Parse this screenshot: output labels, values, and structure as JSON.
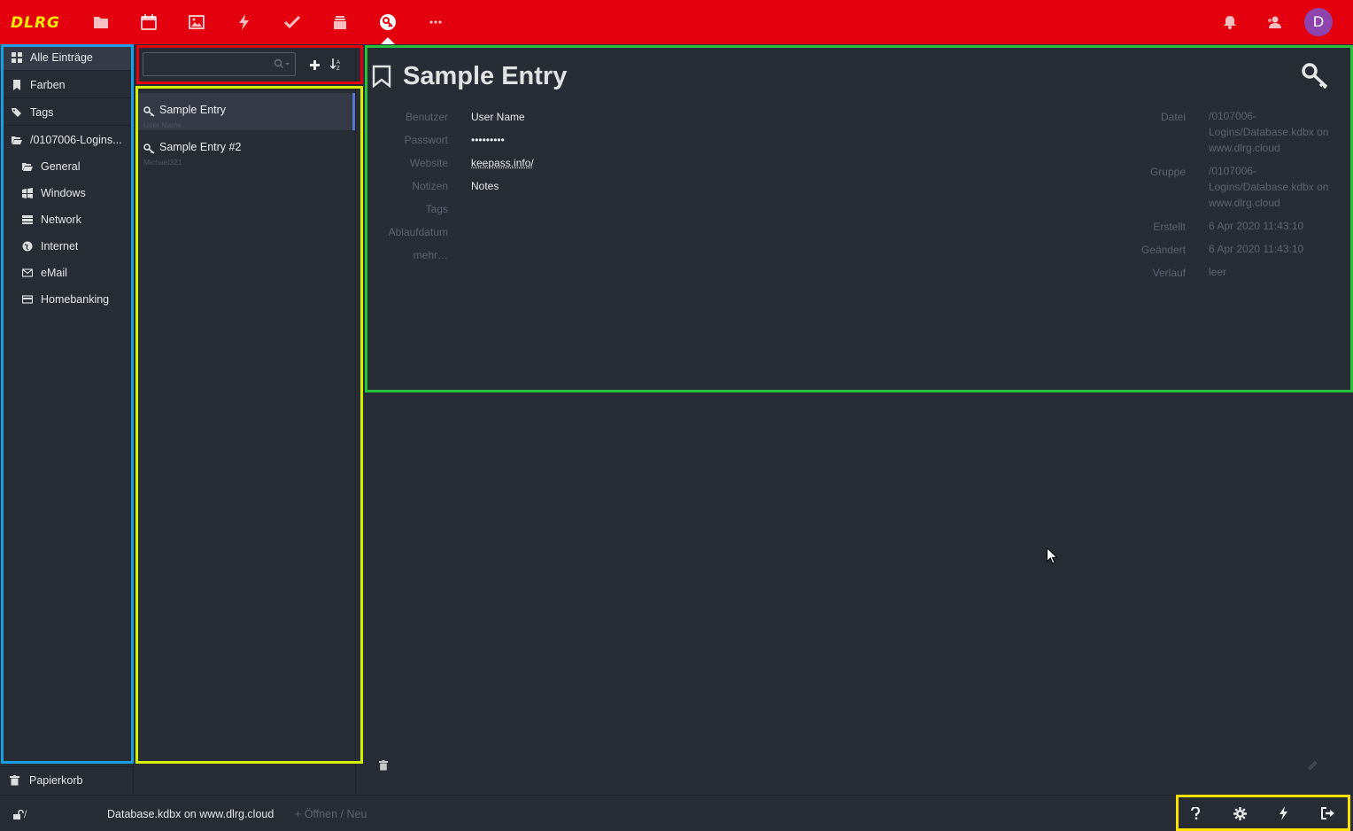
{
  "app": {
    "logo": "DLRG",
    "avatar_letter": "D",
    "brand_color": "#e3000f",
    "logo_color": "#ffed00",
    "avatar_color": "#8e44ad",
    "nav_icons": [
      "folder-icon",
      "calendar-icon",
      "image-icon",
      "bolt-icon",
      "check-icon",
      "inbox-icon",
      "keepass-icon",
      "more-icon",
      "bell-icon",
      "contacts-icon"
    ]
  },
  "sidebar": {
    "items": [
      {
        "label": "Alle Einträge",
        "icon": "grid-icon"
      },
      {
        "label": "Farben",
        "icon": "bookmark-icon"
      },
      {
        "label": "Tags",
        "icon": "tags-icon"
      },
      {
        "label": "/0107006-Logins...",
        "icon": "folder-open-icon"
      },
      {
        "label": "General",
        "icon": "folder-open-icon"
      },
      {
        "label": "Windows",
        "icon": "windows-icon"
      },
      {
        "label": "Network",
        "icon": "server-icon"
      },
      {
        "label": "Internet",
        "icon": "globe-icon"
      },
      {
        "label": "eMail",
        "icon": "envelope-icon"
      },
      {
        "label": "Homebanking",
        "icon": "credit-card-icon"
      }
    ],
    "trash": "Papierkorb"
  },
  "list": {
    "search_value": "",
    "entries": [
      {
        "title": "Sample Entry",
        "subtitle": "User Name"
      },
      {
        "title": "Sample Entry #2",
        "subtitle": "Michael321"
      }
    ]
  },
  "details": {
    "title": "Sample Entry",
    "fields": [
      {
        "label": "Benutzer",
        "value": "User Name"
      },
      {
        "label": "Passwort",
        "value": "•••••••••"
      },
      {
        "label": "Website",
        "value": "keepass.info/"
      },
      {
        "label": "Notizen",
        "value": "Notes"
      },
      {
        "label": "Tags",
        "value": ""
      },
      {
        "label": "Ablaufdatum",
        "value": ""
      },
      {
        "label": "mehr…",
        "value": ""
      }
    ],
    "meta": [
      {
        "label": "Datei",
        "value": "/0107006-Logins/Database.kdbx on www.dlrg.cloud"
      },
      {
        "label": "Gruppe",
        "value": "/0107006-Logins/Database.kdbx on www.dlrg.cloud"
      },
      {
        "label": "Erstellt",
        "value": "6 Apr 2020 11:43:10"
      },
      {
        "label": "Geändert",
        "value": "6 Apr 2020 11:43:10"
      },
      {
        "label": "Verlauf",
        "value": "leer"
      }
    ]
  },
  "footer": {
    "lock_text": "/",
    "file": "Database.kdbx on www.dlrg.cloud",
    "open_new": "+ Öffnen / Neu",
    "buttons": [
      "help-icon",
      "settings-icon",
      "generator-icon",
      "logout-icon"
    ]
  }
}
